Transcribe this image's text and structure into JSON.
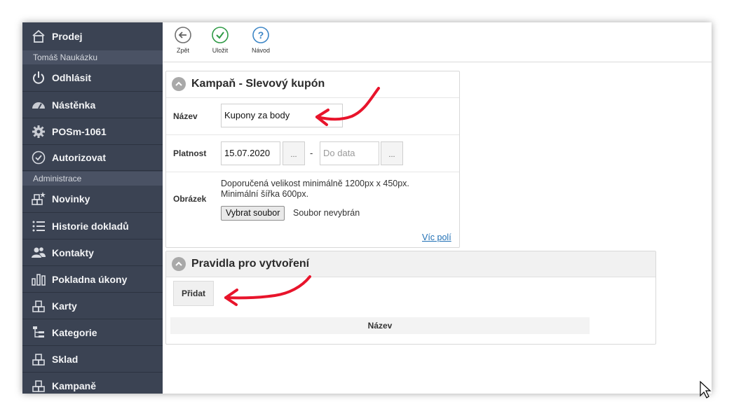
{
  "sidebar": {
    "top_item": {
      "label": "Prodej",
      "icon": "home-icon"
    },
    "user_name": "Tomáš Naukázku",
    "items_top": [
      {
        "label": "Odhlásit",
        "icon": "power-icon"
      },
      {
        "label": "Nástěnka",
        "icon": "dashboard-icon"
      },
      {
        "label": "POSm-1061",
        "icon": "gear-icon"
      },
      {
        "label": "Autorizovat",
        "icon": "check-circle-icon"
      }
    ],
    "section_label": "Administrace",
    "items_admin": [
      {
        "label": "Novinky",
        "icon": "blocks-star-icon"
      },
      {
        "label": "Historie dokladů",
        "icon": "list-icon"
      },
      {
        "label": "Kontakty",
        "icon": "users-icon"
      },
      {
        "label": "Pokladna úkony",
        "icon": "bars-icon"
      },
      {
        "label": "Karty",
        "icon": "blocks-icon"
      },
      {
        "label": "Kategorie",
        "icon": "tree-icon"
      },
      {
        "label": "Sklad",
        "icon": "blocks-icon"
      },
      {
        "label": "Kampaně",
        "icon": "blocks-icon"
      }
    ]
  },
  "toolbar": {
    "back_label": "Zpět",
    "save_label": "Uložit",
    "help_label": "Návod"
  },
  "campaign_panel": {
    "title": "Kampaň - Slevový kupón",
    "name_label": "Název",
    "name_value": "Kupony za body",
    "validity_label": "Platnost",
    "date_from": "15.07.2020",
    "dots": "...",
    "dash": "-",
    "date_to_placeholder": "Do data",
    "image_label": "Obrázek",
    "image_help_1": "Doporučená velikost minimálně 1200px x 450px.",
    "image_help_2": "Minimální šířka 600px.",
    "file_button": "Vybrat soubor",
    "file_status": "Soubor nevybrán",
    "more_fields": "Víc polí"
  },
  "rules_panel": {
    "title": "Pravidla pro vytvoření",
    "add_button": "Přidat",
    "column_name": "Název"
  },
  "colors": {
    "sidebar_bg": "#3b4353",
    "annotation_arrow": "#e8142b",
    "link": "#1f6fb5"
  }
}
